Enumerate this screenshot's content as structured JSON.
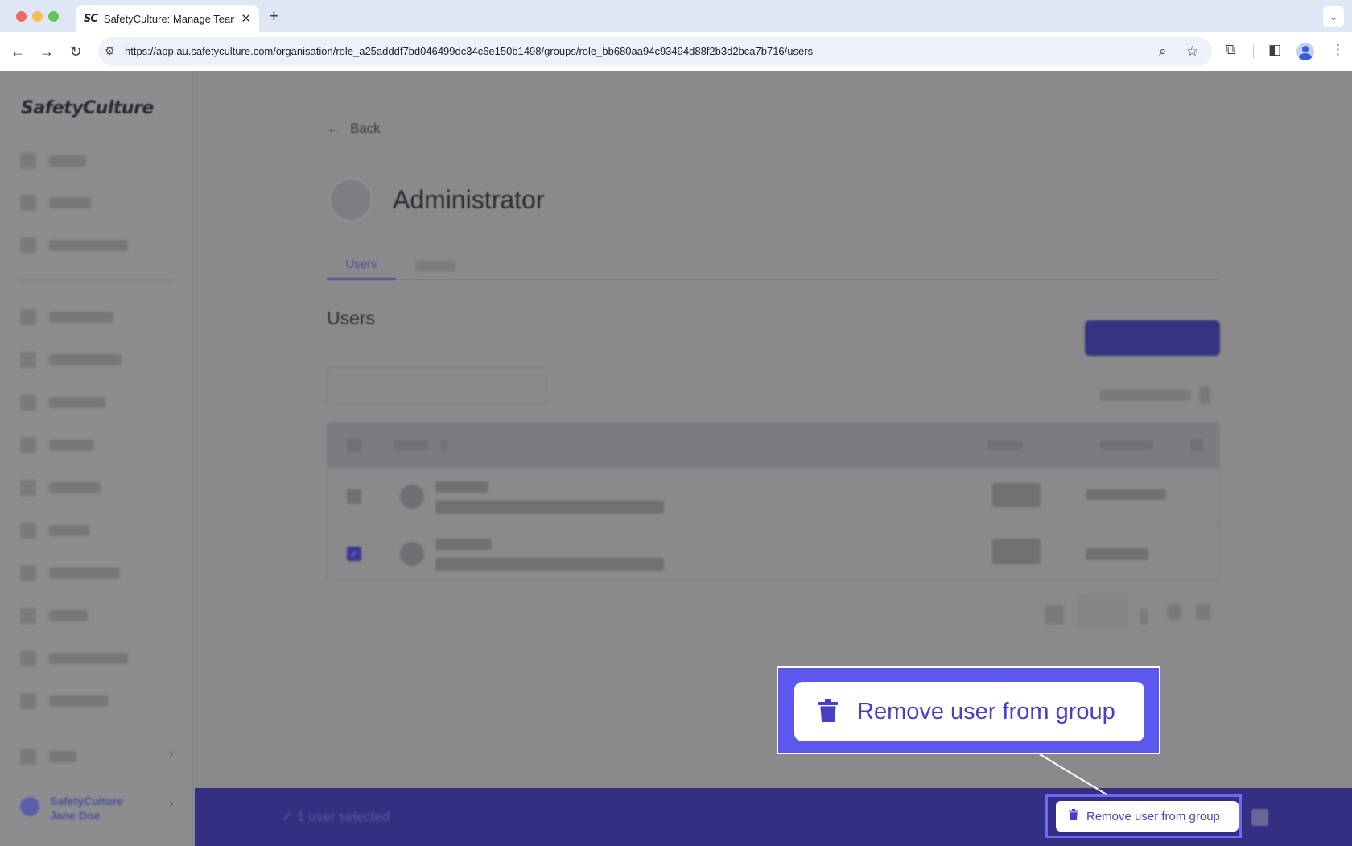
{
  "browser": {
    "tab_title": "SafetyCulture: Manage Teams and...",
    "tab_favicon": "SC",
    "url": "https://app.au.safetyculture.com/organisation/role_a25adddf7bd046499dc34c6e150b1498/groups/role_bb680aa94c93494d88f2b3d2bca7b716/users",
    "icons": [
      "back-icon",
      "forward-icon",
      "reload-icon",
      "site-info-icon",
      "zoom-icon",
      "bookmark-star-icon",
      "extensions-icon",
      "side-panel-icon",
      "profile-icon",
      "menu-icon"
    ]
  },
  "sidebar": {
    "logo": "SafetyCulture",
    "org_name": "SafetyCulture",
    "user_name": "Jane Doe"
  },
  "main": {
    "back_label": "Back",
    "role_title": "Administrator",
    "tabs": [
      {
        "label": "Users",
        "active": true
      }
    ],
    "users_heading": "Users"
  },
  "selection_bar": {
    "count_label": "1 user selected",
    "remove_label": "Remove user from group"
  },
  "callout": {
    "label": "Remove user from group"
  },
  "colors": {
    "accent": "#4540c9",
    "selection_bar": "#352f83",
    "callout_frame": "#5c58ef"
  }
}
